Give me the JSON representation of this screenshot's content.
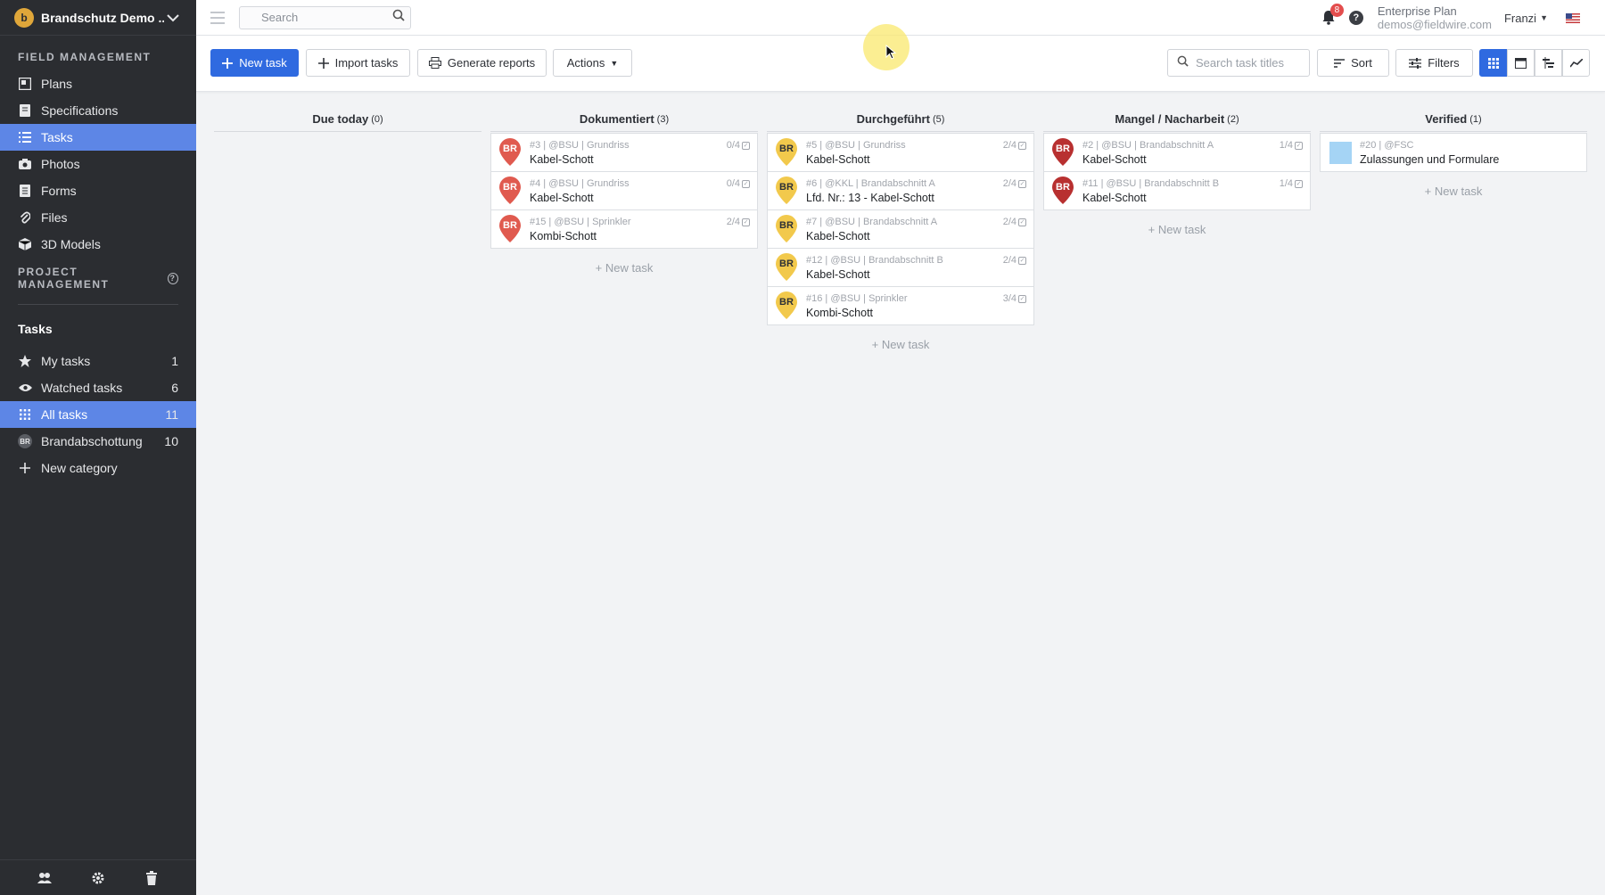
{
  "sidebar": {
    "project_logo": "b",
    "project_name": "Brandschutz Demo ...",
    "field_management_title": "FIELD MANAGEMENT",
    "field_items": [
      {
        "label": "Plans",
        "icon": "plans-icon"
      },
      {
        "label": "Specifications",
        "icon": "book-icon"
      },
      {
        "label": "Tasks",
        "icon": "list-icon",
        "active": true
      },
      {
        "label": "Photos",
        "icon": "camera-icon"
      },
      {
        "label": "Forms",
        "icon": "forms-icon"
      },
      {
        "label": "Files",
        "icon": "paperclip-icon"
      },
      {
        "label": "3D Models",
        "icon": "cube-icon"
      }
    ],
    "project_management_title": "PROJECT MANAGEMENT",
    "tasks_heading": "Tasks",
    "task_items": [
      {
        "label": "My tasks",
        "count": "1",
        "icon": "star-icon"
      },
      {
        "label": "Watched tasks",
        "count": "6",
        "icon": "eye-icon"
      },
      {
        "label": "All tasks",
        "count": "11",
        "icon": "grid-icon",
        "active": true
      },
      {
        "label": "Brandabschottung",
        "count": "10",
        "icon": "br-category-icon",
        "abbr": "BR"
      },
      {
        "label": "New category",
        "count": "",
        "icon": "plus-icon"
      }
    ]
  },
  "topbar": {
    "search_placeholder": "Search",
    "notification_count": "8",
    "plan_name": "Enterprise Plan",
    "email": "demos@fieldwire.com",
    "user_name": "Franzi",
    "help": "?"
  },
  "toolbar": {
    "new_task_label": "New task",
    "import_label": "Import tasks",
    "reports_label": "Generate reports",
    "actions_label": "Actions",
    "task_search_placeholder": "Search task titles",
    "sort_label": "Sort",
    "filters_label": "Filters"
  },
  "colors": {
    "accent": "#2f6ae0",
    "sidebar_bg": "#2b2d31",
    "sidebar_active": "#5d86e6",
    "pin_red": "#e05a4f",
    "pin_darkred": "#b83030",
    "pin_yellow": "#f2c94c",
    "swatch_blue": "#a5d4f5"
  },
  "board": {
    "add_task_label": "+ New task",
    "columns": [
      {
        "title": "Due today",
        "count": "(0)",
        "cards": []
      },
      {
        "title": "Dokumentiert",
        "count": "(3)",
        "cards": [
          {
            "meta": "#3 | @BSU | Grundriss",
            "title": "Kabel-Schott",
            "progress": "0/4",
            "pin": "BR",
            "pin_color": "red"
          },
          {
            "meta": "#4 | @BSU | Grundriss",
            "title": "Kabel-Schott",
            "progress": "0/4",
            "pin": "BR",
            "pin_color": "red"
          },
          {
            "meta": "#15 | @BSU | Sprinkler",
            "title": "Kombi-Schott",
            "progress": "2/4",
            "pin": "BR",
            "pin_color": "red"
          }
        ]
      },
      {
        "title": "Durchgeführt",
        "count": "(5)",
        "cards": [
          {
            "meta": "#5 | @BSU | Grundriss",
            "title": "Kabel-Schott",
            "progress": "2/4",
            "pin": "BR",
            "pin_color": "yellow"
          },
          {
            "meta": "#6 | @KKL | Brandabschnitt A",
            "title": "Lfd. Nr.: 13 - Kabel-Schott",
            "progress": "2/4",
            "pin": "BR",
            "pin_color": "yellow"
          },
          {
            "meta": "#7 | @BSU | Brandabschnitt A",
            "title": "Kabel-Schott",
            "progress": "2/4",
            "pin": "BR",
            "pin_color": "yellow"
          },
          {
            "meta": "#12 | @BSU | Brandabschnitt B",
            "title": "Kabel-Schott",
            "progress": "2/4",
            "pin": "BR",
            "pin_color": "yellow"
          },
          {
            "meta": "#16 | @BSU | Sprinkler",
            "title": "Kombi-Schott",
            "progress": "3/4",
            "pin": "BR",
            "pin_color": "yellow"
          }
        ]
      },
      {
        "title": "Mangel / Nacharbeit",
        "count": "(2)",
        "cards": [
          {
            "meta": "#2 | @BSU | Brandabschnitt A",
            "title": "Kabel-Schott",
            "progress": "1/4",
            "pin": "BR",
            "pin_color": "darkred"
          },
          {
            "meta": "#11 | @BSU | Brandabschnitt B",
            "title": "Kabel-Schott",
            "progress": "1/4",
            "pin": "BR",
            "pin_color": "darkred"
          }
        ]
      },
      {
        "title": "Verified",
        "count": "(1)",
        "cards": [
          {
            "meta": "#20 | @FSC",
            "title": "Zulassungen und Formulare",
            "progress": "",
            "pin": "",
            "pin_color": "swatch"
          }
        ]
      }
    ]
  }
}
